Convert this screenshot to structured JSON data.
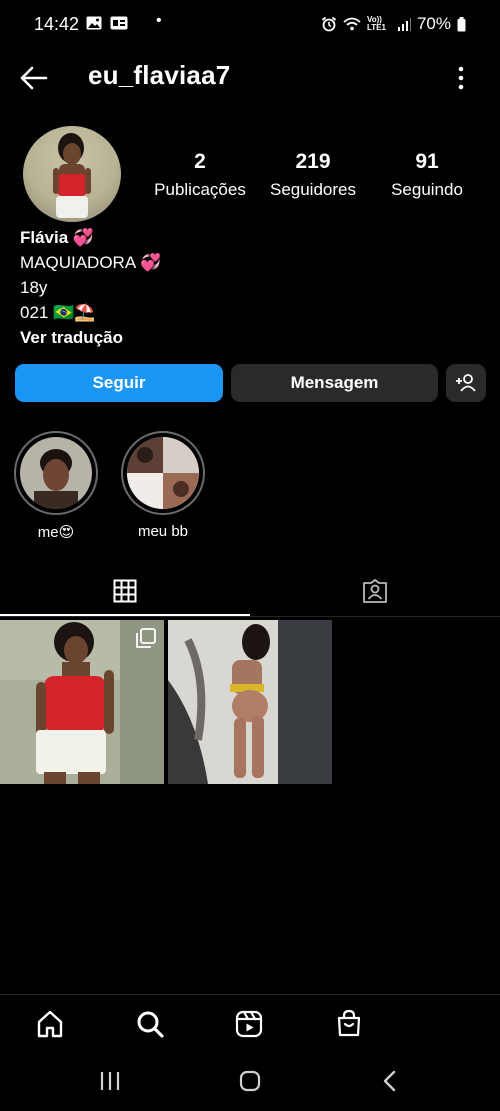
{
  "status_bar": {
    "time": "14:42",
    "network": "Vo)) LTE1",
    "battery": "70%"
  },
  "header": {
    "username": "eu_flaviaa7"
  },
  "stats": {
    "posts": {
      "value": "2",
      "label": "Publicações"
    },
    "followers": {
      "value": "219",
      "label": "Seguidores"
    },
    "following": {
      "value": "91",
      "label": "Seguindo"
    }
  },
  "bio": {
    "name": "Flávia 💞",
    "line1": "MAQUIADORA 💞",
    "line2": "18y",
    "line3": "021 🇧🇷⛱️",
    "translate": "Ver tradução"
  },
  "actions": {
    "follow": "Seguir",
    "message": "Mensagem"
  },
  "highlights": [
    {
      "label": "me😍"
    },
    {
      "label": "meu bb"
    }
  ],
  "colors": {
    "accent": "#1c96f5",
    "background": "#000000",
    "button_secondary": "#2a2a2a"
  },
  "icons": {
    "back": "arrow-left-icon",
    "more": "kebab-icon",
    "suggest": "add-person-icon",
    "grid_tab": "grid-icon",
    "tagged_tab": "tagged-person-icon",
    "home": "home-icon",
    "search": "search-icon",
    "reels": "reels-icon",
    "shop": "shopping-bag-icon"
  }
}
